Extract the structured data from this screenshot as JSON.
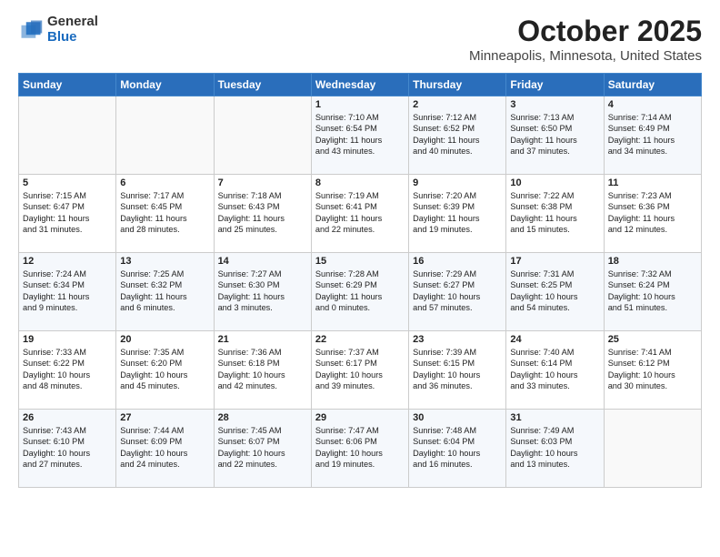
{
  "header": {
    "logo_general": "General",
    "logo_blue": "Blue",
    "title": "October 2025",
    "subtitle": "Minneapolis, Minnesota, United States"
  },
  "days_of_week": [
    "Sunday",
    "Monday",
    "Tuesday",
    "Wednesday",
    "Thursday",
    "Friday",
    "Saturday"
  ],
  "weeks": [
    [
      {
        "day": "",
        "text": ""
      },
      {
        "day": "",
        "text": ""
      },
      {
        "day": "",
        "text": ""
      },
      {
        "day": "1",
        "text": "Sunrise: 7:10 AM\nSunset: 6:54 PM\nDaylight: 11 hours\nand 43 minutes."
      },
      {
        "day": "2",
        "text": "Sunrise: 7:12 AM\nSunset: 6:52 PM\nDaylight: 11 hours\nand 40 minutes."
      },
      {
        "day": "3",
        "text": "Sunrise: 7:13 AM\nSunset: 6:50 PM\nDaylight: 11 hours\nand 37 minutes."
      },
      {
        "day": "4",
        "text": "Sunrise: 7:14 AM\nSunset: 6:49 PM\nDaylight: 11 hours\nand 34 minutes."
      }
    ],
    [
      {
        "day": "5",
        "text": "Sunrise: 7:15 AM\nSunset: 6:47 PM\nDaylight: 11 hours\nand 31 minutes."
      },
      {
        "day": "6",
        "text": "Sunrise: 7:17 AM\nSunset: 6:45 PM\nDaylight: 11 hours\nand 28 minutes."
      },
      {
        "day": "7",
        "text": "Sunrise: 7:18 AM\nSunset: 6:43 PM\nDaylight: 11 hours\nand 25 minutes."
      },
      {
        "day": "8",
        "text": "Sunrise: 7:19 AM\nSunset: 6:41 PM\nDaylight: 11 hours\nand 22 minutes."
      },
      {
        "day": "9",
        "text": "Sunrise: 7:20 AM\nSunset: 6:39 PM\nDaylight: 11 hours\nand 19 minutes."
      },
      {
        "day": "10",
        "text": "Sunrise: 7:22 AM\nSunset: 6:38 PM\nDaylight: 11 hours\nand 15 minutes."
      },
      {
        "day": "11",
        "text": "Sunrise: 7:23 AM\nSunset: 6:36 PM\nDaylight: 11 hours\nand 12 minutes."
      }
    ],
    [
      {
        "day": "12",
        "text": "Sunrise: 7:24 AM\nSunset: 6:34 PM\nDaylight: 11 hours\nand 9 minutes."
      },
      {
        "day": "13",
        "text": "Sunrise: 7:25 AM\nSunset: 6:32 PM\nDaylight: 11 hours\nand 6 minutes."
      },
      {
        "day": "14",
        "text": "Sunrise: 7:27 AM\nSunset: 6:30 PM\nDaylight: 11 hours\nand 3 minutes."
      },
      {
        "day": "15",
        "text": "Sunrise: 7:28 AM\nSunset: 6:29 PM\nDaylight: 11 hours\nand 0 minutes."
      },
      {
        "day": "16",
        "text": "Sunrise: 7:29 AM\nSunset: 6:27 PM\nDaylight: 10 hours\nand 57 minutes."
      },
      {
        "day": "17",
        "text": "Sunrise: 7:31 AM\nSunset: 6:25 PM\nDaylight: 10 hours\nand 54 minutes."
      },
      {
        "day": "18",
        "text": "Sunrise: 7:32 AM\nSunset: 6:24 PM\nDaylight: 10 hours\nand 51 minutes."
      }
    ],
    [
      {
        "day": "19",
        "text": "Sunrise: 7:33 AM\nSunset: 6:22 PM\nDaylight: 10 hours\nand 48 minutes."
      },
      {
        "day": "20",
        "text": "Sunrise: 7:35 AM\nSunset: 6:20 PM\nDaylight: 10 hours\nand 45 minutes."
      },
      {
        "day": "21",
        "text": "Sunrise: 7:36 AM\nSunset: 6:18 PM\nDaylight: 10 hours\nand 42 minutes."
      },
      {
        "day": "22",
        "text": "Sunrise: 7:37 AM\nSunset: 6:17 PM\nDaylight: 10 hours\nand 39 minutes."
      },
      {
        "day": "23",
        "text": "Sunrise: 7:39 AM\nSunset: 6:15 PM\nDaylight: 10 hours\nand 36 minutes."
      },
      {
        "day": "24",
        "text": "Sunrise: 7:40 AM\nSunset: 6:14 PM\nDaylight: 10 hours\nand 33 minutes."
      },
      {
        "day": "25",
        "text": "Sunrise: 7:41 AM\nSunset: 6:12 PM\nDaylight: 10 hours\nand 30 minutes."
      }
    ],
    [
      {
        "day": "26",
        "text": "Sunrise: 7:43 AM\nSunset: 6:10 PM\nDaylight: 10 hours\nand 27 minutes."
      },
      {
        "day": "27",
        "text": "Sunrise: 7:44 AM\nSunset: 6:09 PM\nDaylight: 10 hours\nand 24 minutes."
      },
      {
        "day": "28",
        "text": "Sunrise: 7:45 AM\nSunset: 6:07 PM\nDaylight: 10 hours\nand 22 minutes."
      },
      {
        "day": "29",
        "text": "Sunrise: 7:47 AM\nSunset: 6:06 PM\nDaylight: 10 hours\nand 19 minutes."
      },
      {
        "day": "30",
        "text": "Sunrise: 7:48 AM\nSunset: 6:04 PM\nDaylight: 10 hours\nand 16 minutes."
      },
      {
        "day": "31",
        "text": "Sunrise: 7:49 AM\nSunset: 6:03 PM\nDaylight: 10 hours\nand 13 minutes."
      },
      {
        "day": "",
        "text": ""
      }
    ]
  ]
}
